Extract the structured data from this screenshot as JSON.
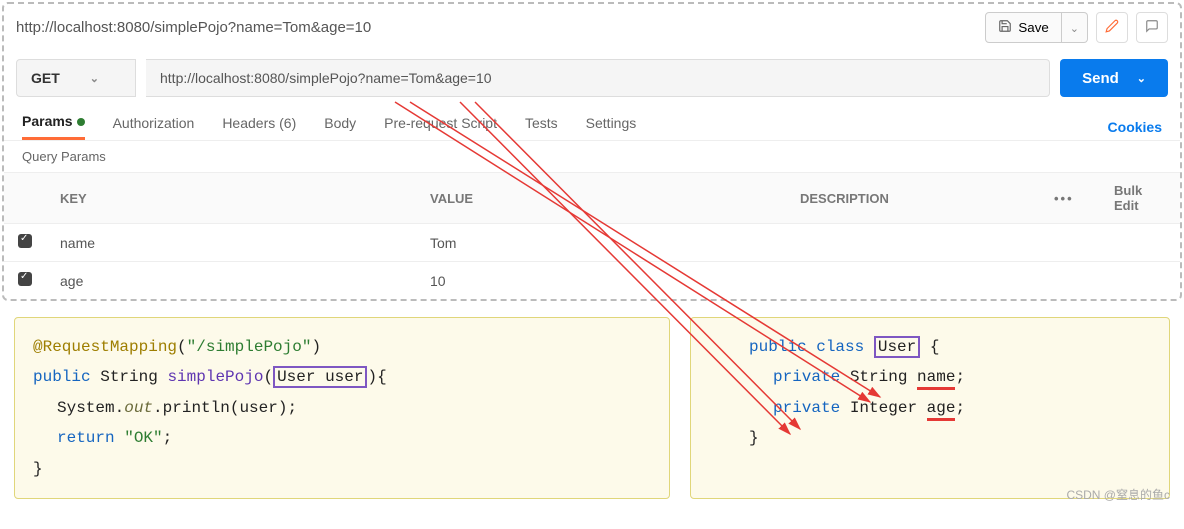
{
  "header": {
    "title": "http://localhost:8080/simplePojo?name=Tom&age=10",
    "save_label": "Save"
  },
  "request": {
    "method": "GET",
    "url": "http://localhost:8080/simplePojo?name=Tom&age=10",
    "send_label": "Send"
  },
  "tabs": {
    "params": "Params",
    "authorization": "Authorization",
    "headers": "Headers (6)",
    "body": "Body",
    "prerequest": "Pre-request Script",
    "tests": "Tests",
    "settings": "Settings",
    "cookies": "Cookies"
  },
  "params": {
    "section_label": "Query Params",
    "columns": {
      "key": "KEY",
      "value": "VALUE",
      "description": "DESCRIPTION",
      "bulk": "Bulk Edit"
    },
    "rows": [
      {
        "key": "name",
        "value": "Tom"
      },
      {
        "key": "age",
        "value": "10"
      }
    ]
  },
  "code": {
    "controller": {
      "ann": "@RequestMapping",
      "ann_arg": "\"/simplePojo\"",
      "sig_kw": "public",
      "sig_type": "String",
      "sig_name": "simplePojo",
      "sig_param": "User user",
      "line1a": "System.",
      "line1b": "out",
      "line1c": ".println(user);",
      "ret_kw": "return",
      "ret_val": "\"OK\""
    },
    "entity": {
      "kw_public": "public",
      "kw_class": "class",
      "class_name": "User",
      "kw_private": "private",
      "type_string": "String",
      "field_name": "name",
      "type_integer": "Integer",
      "field_age": "age"
    }
  },
  "watermark": "CSDN @窒息的鱼c"
}
